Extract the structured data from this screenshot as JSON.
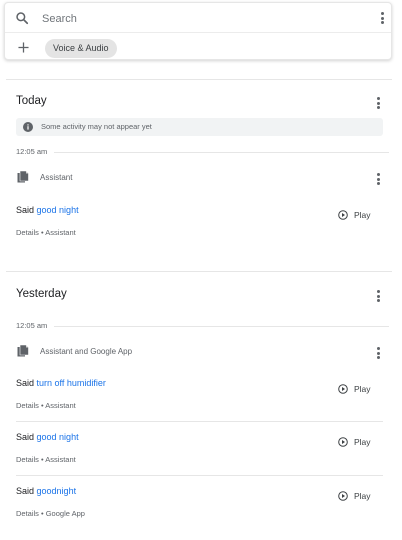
{
  "search": {
    "placeholder": "Search"
  },
  "filter": {
    "chip_label": "Voice & Audio"
  },
  "sections": [
    {
      "title": "Today",
      "notice": "Some activity may not appear yet",
      "time": "12:05 am",
      "product": "Assistant",
      "items": [
        {
          "said": "Said",
          "query": "good night",
          "details": "Details • Assistant",
          "play": "Play"
        }
      ]
    },
    {
      "title": "Yesterday",
      "time": "12:05 am",
      "product": "Assistant and Google App",
      "items": [
        {
          "said": "Said",
          "query": "turn off humidifier",
          "details": "Details • Assistant",
          "play": "Play"
        },
        {
          "said": "Said",
          "query": "good night",
          "details": "Details • Assistant",
          "play": "Play"
        },
        {
          "said": "Said",
          "query": "goodnight",
          "details": "Details • Google App",
          "play": "Play"
        }
      ]
    }
  ],
  "colors": {
    "link": "#1a73e8",
    "secondary_text": "#5f6368",
    "chip_bg": "#e4e4e4"
  },
  "icons": [
    "search-icon",
    "more-vert-icon",
    "plus-icon",
    "info-icon",
    "document-icon",
    "play-circle-icon"
  ]
}
